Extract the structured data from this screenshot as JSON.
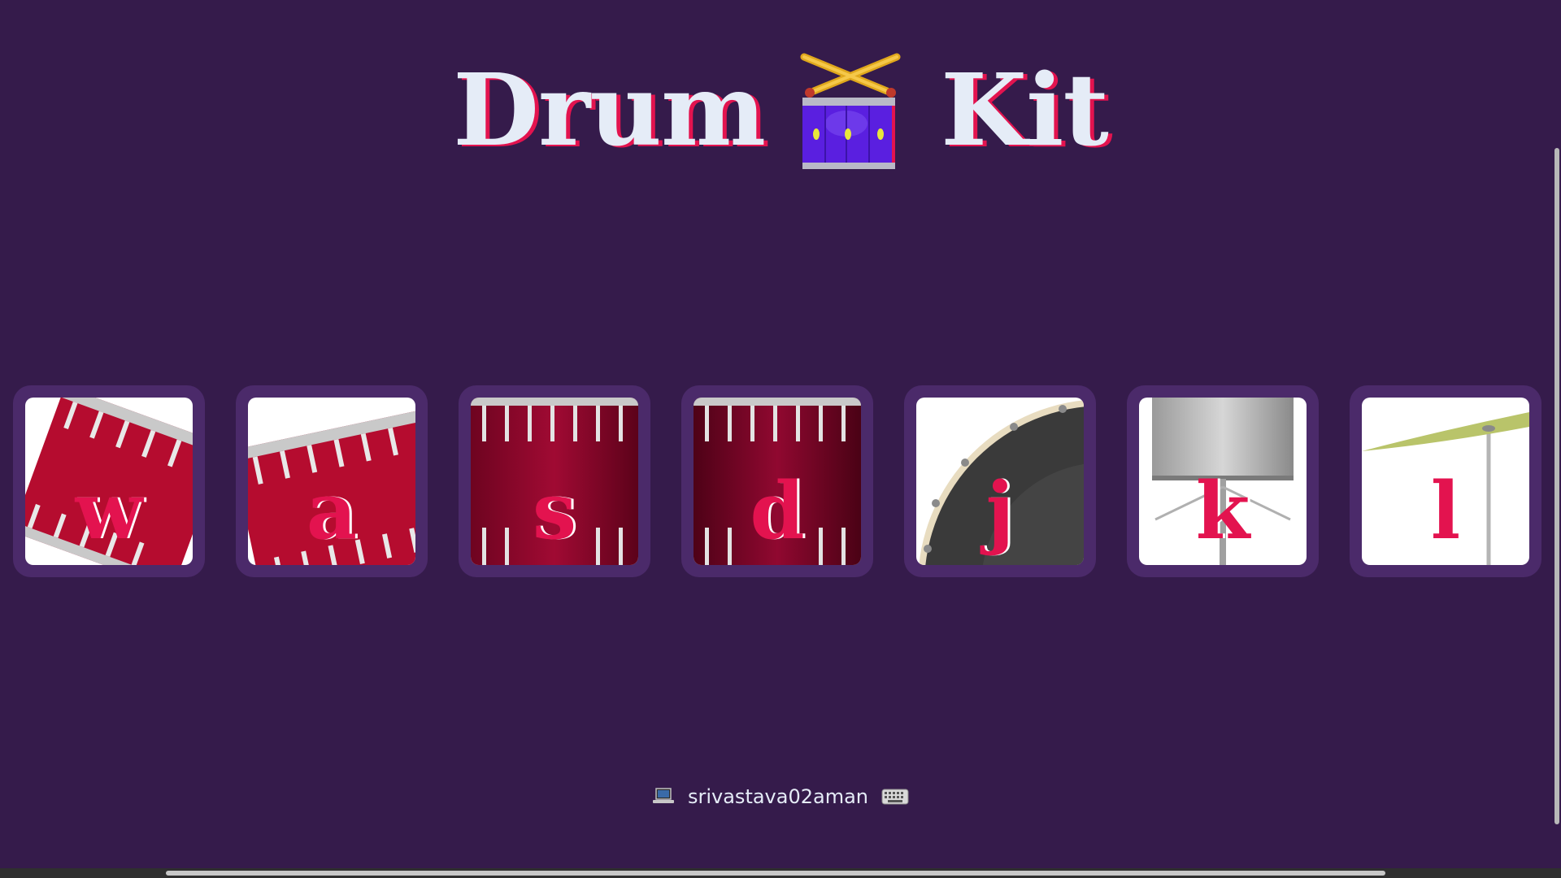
{
  "title": {
    "left_word": "Drum",
    "right_word": "Kit",
    "icon": "drum-emoji"
  },
  "keys": [
    {
      "letter": "w",
      "image": "tom-drum"
    },
    {
      "letter": "a",
      "image": "tom-drum"
    },
    {
      "letter": "s",
      "image": "snare-drum"
    },
    {
      "letter": "d",
      "image": "snare-drum"
    },
    {
      "letter": "j",
      "image": "bass-drum"
    },
    {
      "letter": "k",
      "image": "hi-hat"
    },
    {
      "letter": "l",
      "image": "cymbal"
    }
  ],
  "footer": {
    "left_icon": "laptop-icon",
    "username": "srivastava02aman",
    "right_icon": "keyboard-icon"
  },
  "colors": {
    "background": "#351b4b",
    "key_border": "#4b2a6a",
    "accent": "#e3134f",
    "title_text": "#e5ecf7"
  }
}
